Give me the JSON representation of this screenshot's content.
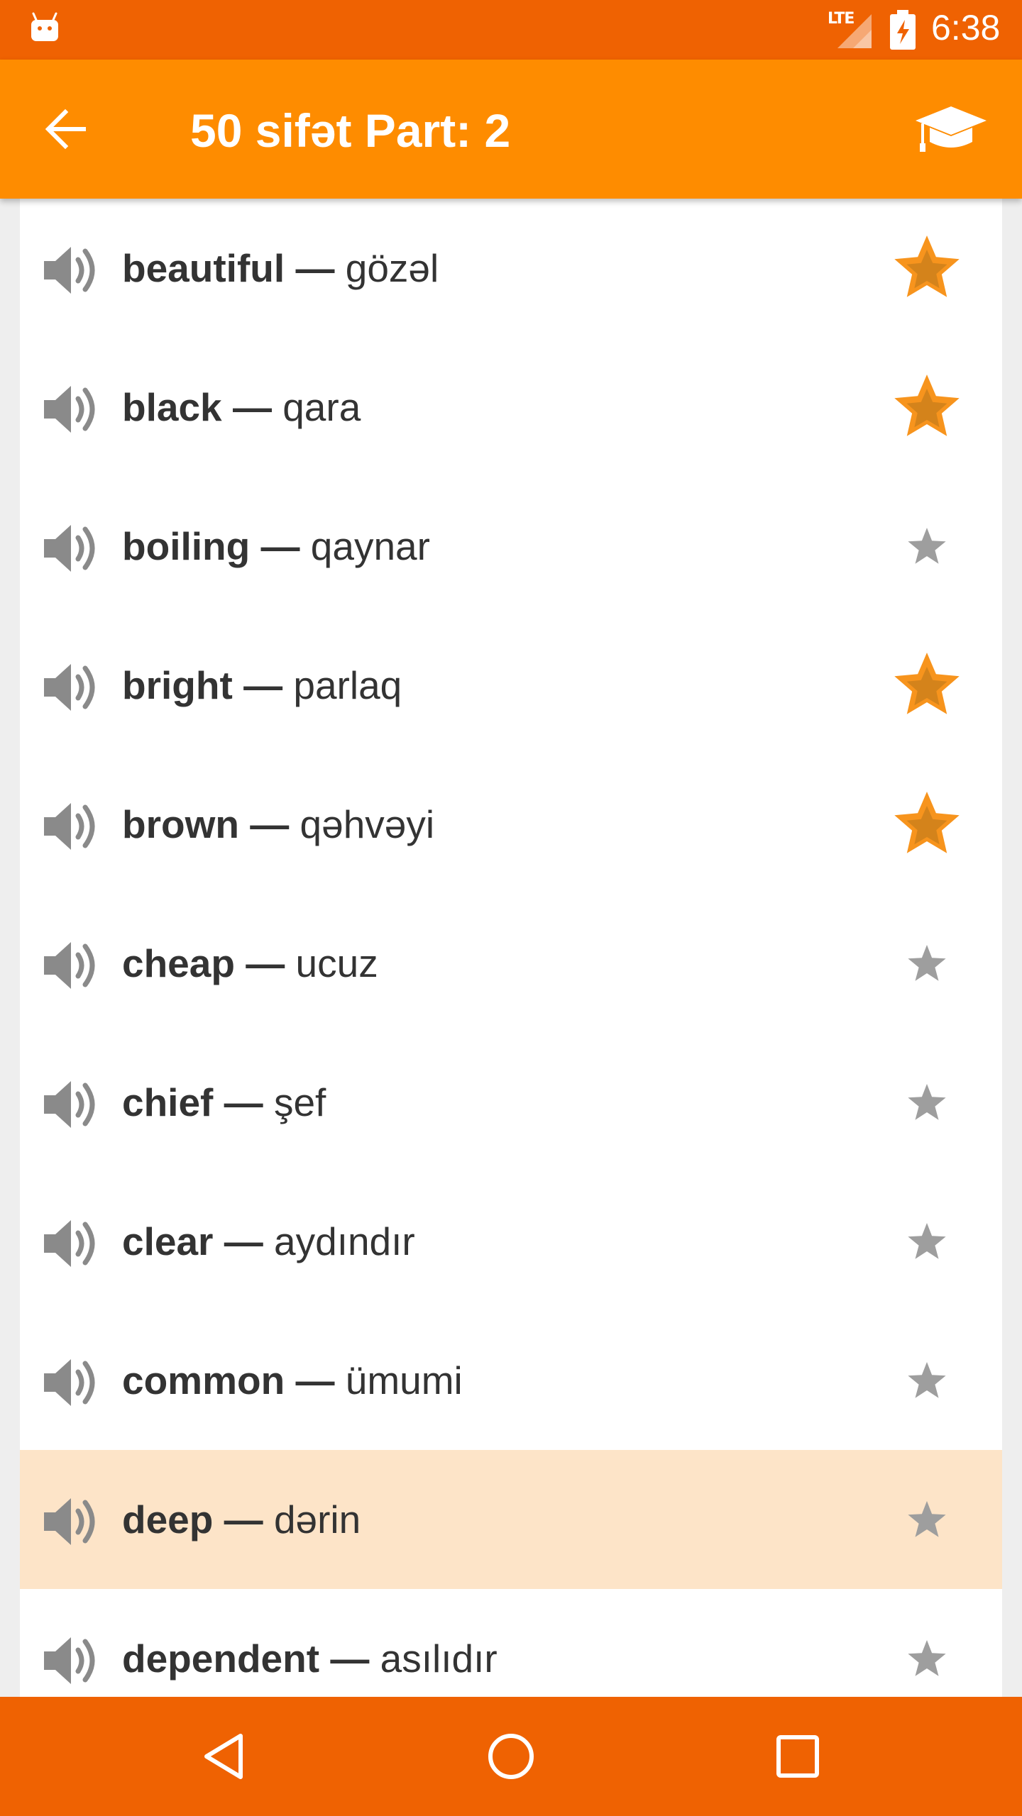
{
  "status_bar": {
    "network": "LTE",
    "time": "6:38",
    "android_icon": "android-debug-icon",
    "signal_icon": "signal-icon",
    "battery_icon": "battery-charging-icon"
  },
  "app_bar": {
    "title": "50 sifət Part: 2",
    "back_icon": "arrow-left-icon",
    "learn_icon": "graduation-cap-icon",
    "background": "#fe8c00"
  },
  "colors": {
    "status_bar": "#ef6202",
    "app_bar": "#fe8c00",
    "star_active": "#f7941d",
    "star_inactive": "#9e9e9e",
    "highlight_row": "#fde4c8",
    "nav_bar": "#ef6202"
  },
  "words": [
    {
      "en": "beautiful",
      "tr": "gözəl",
      "favorite": true,
      "highlighted": false
    },
    {
      "en": "black",
      "tr": "qara",
      "favorite": true,
      "highlighted": false
    },
    {
      "en": "boiling",
      "tr": "qaynar",
      "favorite": false,
      "highlighted": false
    },
    {
      "en": "bright",
      "tr": "parlaq",
      "favorite": true,
      "highlighted": false
    },
    {
      "en": "brown",
      "tr": "qəhvəyi",
      "favorite": true,
      "highlighted": false
    },
    {
      "en": "cheap",
      "tr": "ucuz",
      "favorite": false,
      "highlighted": false
    },
    {
      "en": "chief",
      "tr": "şef",
      "favorite": false,
      "highlighted": false
    },
    {
      "en": "clear",
      "tr": "aydındır",
      "favorite": false,
      "highlighted": false
    },
    {
      "en": "common",
      "tr": "ümumi",
      "favorite": false,
      "highlighted": false
    },
    {
      "en": "deep",
      "tr": "dərin",
      "favorite": false,
      "highlighted": true
    },
    {
      "en": "dependent",
      "tr": "asılıdır",
      "favorite": false,
      "highlighted": false
    }
  ],
  "separator": "—",
  "nav_bar": {
    "back_icon": "nav-back-triangle-icon",
    "home_icon": "nav-home-circle-icon",
    "recents_icon": "nav-recents-square-icon"
  }
}
